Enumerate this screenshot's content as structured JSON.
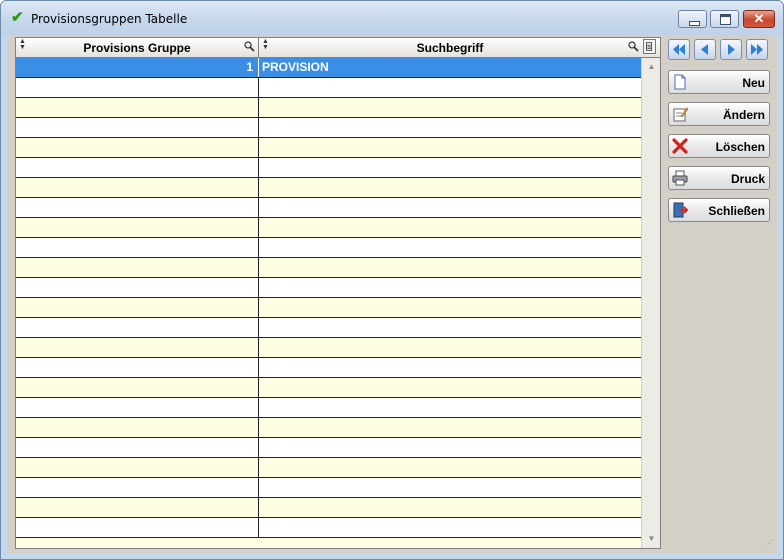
{
  "window": {
    "title": "Provisionsgruppen Tabelle",
    "close_glyph": "✕"
  },
  "grid": {
    "columns": [
      {
        "label": "Provisions Gruppe"
      },
      {
        "label": "Suchbegriff"
      }
    ],
    "rows": [
      {
        "gruppe": "1",
        "suchbegriff": "PROVISION",
        "selected": true
      }
    ],
    "empty_row_count": 23
  },
  "nav": {
    "first": "first-record",
    "prev": "previous-record",
    "next": "next-record",
    "last": "last-record"
  },
  "actions": {
    "neu": "Neu",
    "aendern": "Ändern",
    "loeschen": "Löschen",
    "druck": "Druck",
    "schliessen": "Schließen"
  },
  "colors": {
    "selected_row": "#3a8ee6",
    "row_alt": "#fdfde2",
    "title_check": "#2a9a1a"
  }
}
